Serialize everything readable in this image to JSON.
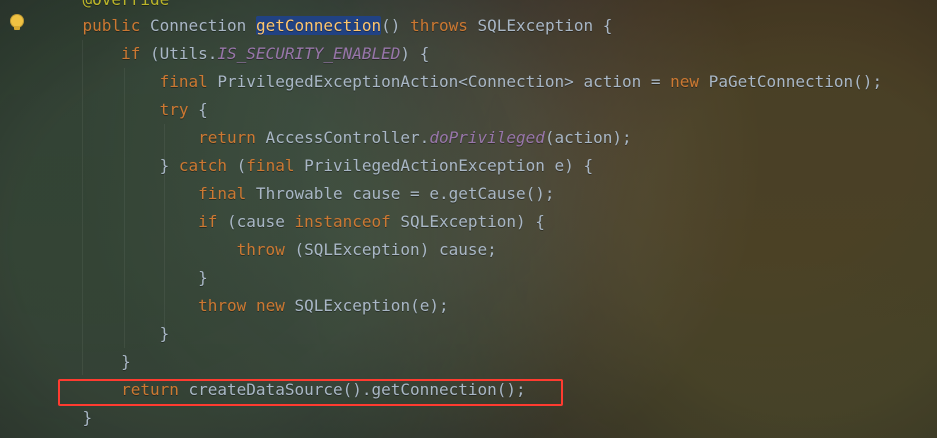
{
  "editor": {
    "lines": [
      {
        "id": "l0",
        "tokens": [
          {
            "t": "@Override",
            "k": "anno"
          }
        ],
        "indent": "    "
      },
      {
        "id": "l1",
        "tokens": [
          {
            "t": "public",
            "k": "kw"
          },
          {
            "t": " ",
            "k": "punct"
          },
          {
            "t": "Connection",
            "k": "type"
          },
          {
            "t": " ",
            "k": "punct"
          },
          {
            "t": "getConnection",
            "k": "method",
            "selected": true
          },
          {
            "t": "() ",
            "k": "punct"
          },
          {
            "t": "throws",
            "k": "kw"
          },
          {
            "t": " SQLException {",
            "k": "type"
          }
        ],
        "indent": "    "
      },
      {
        "id": "l2",
        "tokens": [
          {
            "t": "if",
            "k": "kw"
          },
          {
            "t": " (Utils.",
            "k": "punct"
          },
          {
            "t": "IS_SECURITY_ENABLED",
            "k": "static"
          },
          {
            "t": ") {",
            "k": "punct"
          }
        ],
        "indent": "        "
      },
      {
        "id": "l3",
        "tokens": [
          {
            "t": "final",
            "k": "kw"
          },
          {
            "t": " PrivilegedExceptionAction<Connection> action = ",
            "k": "type"
          },
          {
            "t": "new",
            "k": "kw"
          },
          {
            "t": " PaGetConnection();",
            "k": "type"
          }
        ],
        "indent": "            "
      },
      {
        "id": "l4",
        "tokens": [
          {
            "t": "try",
            "k": "kw"
          },
          {
            "t": " {",
            "k": "punct"
          }
        ],
        "indent": "            "
      },
      {
        "id": "l5",
        "tokens": [
          {
            "t": "return",
            "k": "kw"
          },
          {
            "t": " AccessController.",
            "k": "type"
          },
          {
            "t": "doPrivileged",
            "k": "static"
          },
          {
            "t": "(action);",
            "k": "punct"
          }
        ],
        "indent": "                "
      },
      {
        "id": "l6",
        "tokens": [
          {
            "t": "} ",
            "k": "punct"
          },
          {
            "t": "catch",
            "k": "kw"
          },
          {
            "t": " (",
            "k": "punct"
          },
          {
            "t": "final",
            "k": "kw"
          },
          {
            "t": " PrivilegedActionException e) {",
            "k": "type"
          }
        ],
        "indent": "            "
      },
      {
        "id": "l7",
        "tokens": [
          {
            "t": "final",
            "k": "kw"
          },
          {
            "t": " Throwable cause = e.getCause();",
            "k": "type"
          }
        ],
        "indent": "                "
      },
      {
        "id": "l8",
        "tokens": [
          {
            "t": "if",
            "k": "kw"
          },
          {
            "t": " (cause ",
            "k": "punct"
          },
          {
            "t": "instanceof",
            "k": "kw"
          },
          {
            "t": " SQLException) {",
            "k": "type"
          }
        ],
        "indent": "                "
      },
      {
        "id": "l9",
        "tokens": [
          {
            "t": "throw",
            "k": "kw"
          },
          {
            "t": " (SQLException) cause;",
            "k": "type"
          }
        ],
        "indent": "                    "
      },
      {
        "id": "l10",
        "tokens": [
          {
            "t": "}",
            "k": "punct"
          }
        ],
        "indent": "                "
      },
      {
        "id": "l11",
        "tokens": [
          {
            "t": "throw",
            "k": "kw"
          },
          {
            "t": " ",
            "k": "punct"
          },
          {
            "t": "new",
            "k": "kw"
          },
          {
            "t": " SQLException(e);",
            "k": "type"
          }
        ],
        "indent": "                "
      },
      {
        "id": "l12",
        "tokens": [
          {
            "t": "}",
            "k": "punct"
          }
        ],
        "indent": "            "
      },
      {
        "id": "l13",
        "tokens": [
          {
            "t": "}",
            "k": "punct"
          }
        ],
        "indent": "        "
      },
      {
        "id": "l14",
        "tokens": [
          {
            "t": "return",
            "k": "kw"
          },
          {
            "t": " createDataSource().getConnection();",
            "k": "type"
          }
        ],
        "indent": "        "
      },
      {
        "id": "l15",
        "tokens": [
          {
            "t": "}",
            "k": "punct"
          }
        ],
        "indent": "    "
      }
    ]
  },
  "icons": {
    "gutter": {
      "name": "lightbulb-icon"
    }
  },
  "annotations": {
    "highlight_color": "#ff3b30"
  },
  "colors": {
    "keyword": "#cc7832",
    "method": "#ffc66d",
    "static": "#9876aa",
    "default": "#a9b7c6",
    "annotation": "#bbb529",
    "selection": "#214283"
  }
}
